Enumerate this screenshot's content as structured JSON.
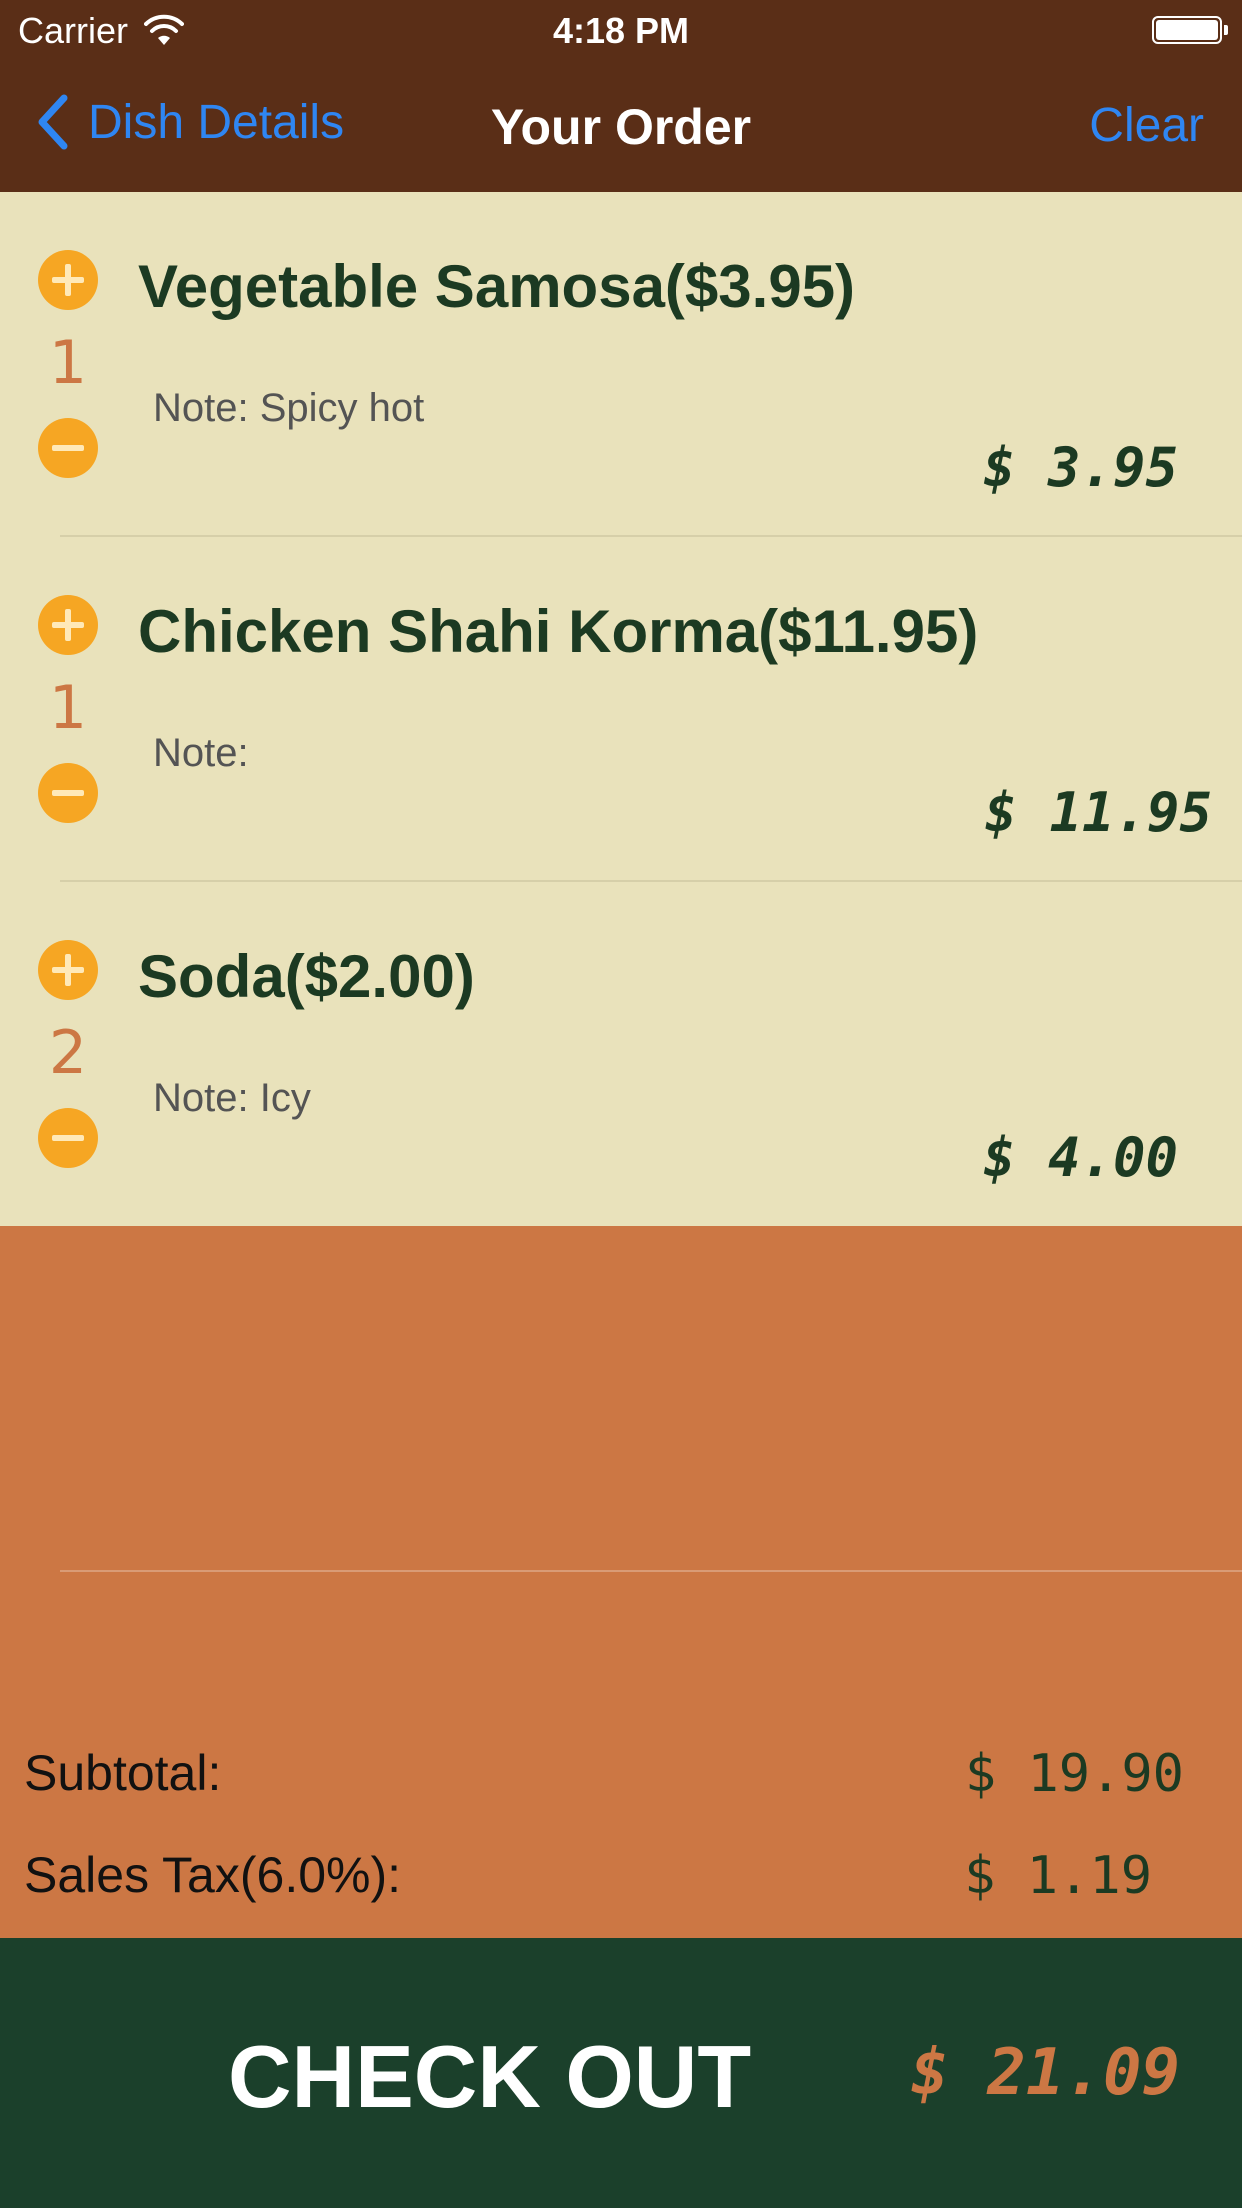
{
  "status_bar": {
    "carrier": "Carrier",
    "time": "4:18 PM"
  },
  "nav": {
    "back_label": "Dish Details",
    "title": "Your Order",
    "clear_label": "Clear"
  },
  "order_items": [
    {
      "name": "Vegetable Samosa($3.95)",
      "quantity": "1",
      "note": "Note: Spicy hot",
      "line_total": "$ 3.95"
    },
    {
      "name": "Chicken Shahi Korma($11.95)",
      "quantity": "1",
      "note": "Note:",
      "line_total": "$ 11.95"
    },
    {
      "name": "Soda($2.00)",
      "quantity": "2",
      "note": "Note: Icy",
      "line_total": "$ 4.00"
    }
  ],
  "summary": {
    "subtotal_label": "Subtotal:",
    "subtotal_value": "$ 19.90",
    "tax_label": "Sales Tax(6.0%):",
    "tax_value": "$ 1.19"
  },
  "checkout": {
    "label": "CHECK OUT",
    "total": "$ 21.09"
  },
  "colors": {
    "nav_background": "#5a2e17",
    "list_background": "#e9e2bb",
    "page_background": "#cc7744",
    "checkout_background": "#1b402b",
    "accent_button": "#f6a623",
    "link_blue": "#2f86f2",
    "dish_text": "#1c3a22"
  },
  "icons": {
    "back": "chevron-left-icon",
    "wifi": "wifi-icon",
    "battery": "battery-icon",
    "increment": "plus-circle-icon",
    "decrement": "minus-circle-icon"
  }
}
